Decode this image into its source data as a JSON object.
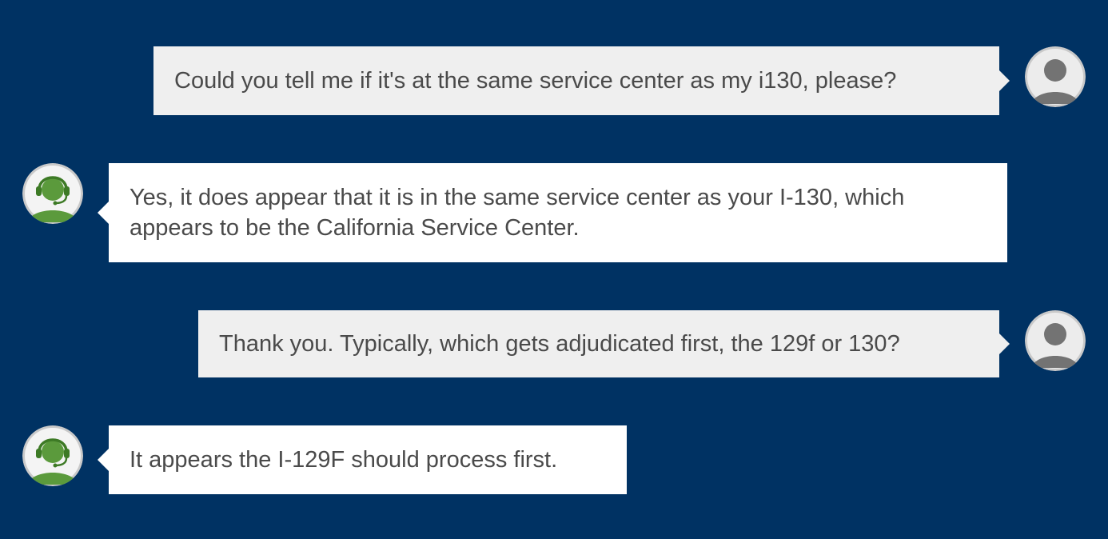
{
  "conversation": {
    "messages": [
      {
        "sender": "user",
        "avatar_icon": "user-avatar-icon",
        "text": "Could you tell me if it's at the same service center as my i130, please?"
      },
      {
        "sender": "agent",
        "avatar_icon": "support-agent-headset-icon",
        "text": "Yes, it does appear that it is in the same service center as your I-130, which appears to be the California Service Center."
      },
      {
        "sender": "user",
        "avatar_icon": "user-avatar-icon",
        "text": "Thank you. Typically, which gets adjudicated first, the 129f or 130?"
      },
      {
        "sender": "agent",
        "avatar_icon": "support-agent-headset-icon",
        "text": "It appears the I-129F should process first."
      }
    ]
  },
  "colors": {
    "background": "#003263",
    "user_bubble": "#efefef",
    "agent_bubble": "#ffffff",
    "text": "#4a4a4a",
    "agent_accent": "#5b9a3c"
  }
}
